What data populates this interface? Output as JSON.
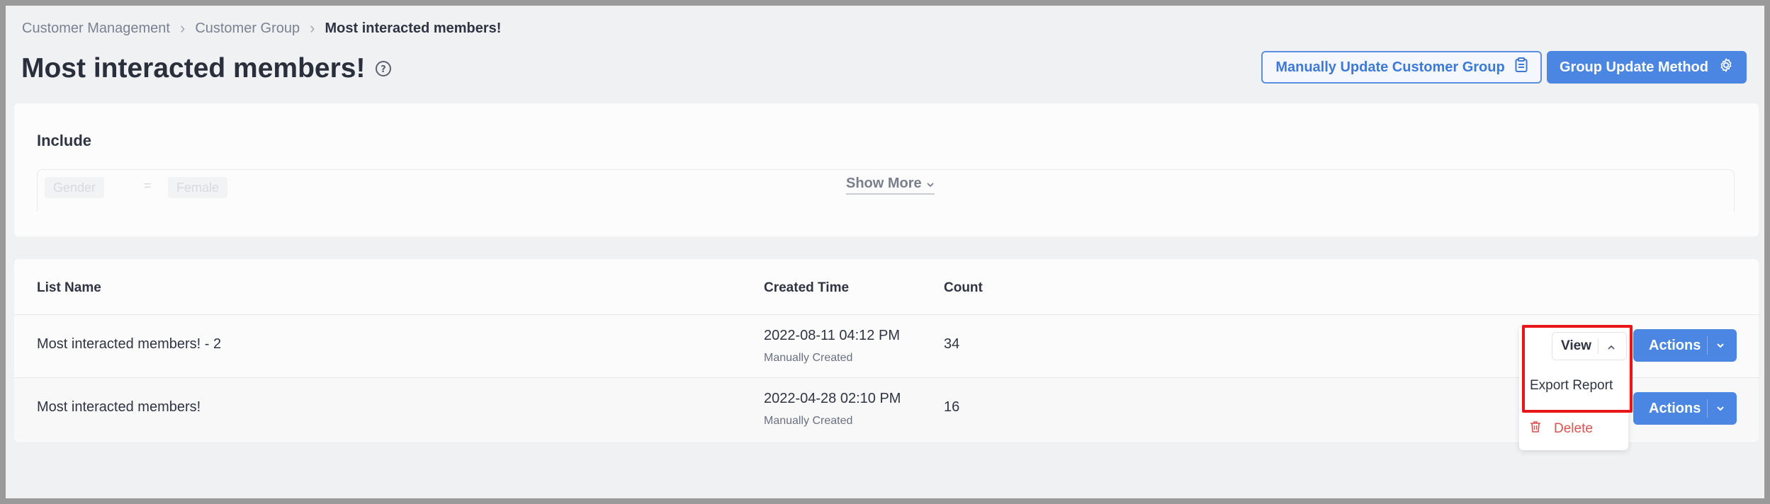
{
  "breadcrumb": {
    "items": [
      "Customer Management",
      "Customer Group"
    ],
    "current": "Most interacted members!"
  },
  "header": {
    "title": "Most interacted members!",
    "manual_update_label": "Manually Update Customer Group",
    "update_method_label": "Group Update Method"
  },
  "include": {
    "title": "Include",
    "rule": {
      "field": "Gender",
      "operator": "=",
      "value": "Female"
    },
    "show_more_label": "Show More"
  },
  "table": {
    "columns": [
      "List Name",
      "Created Time",
      "Count"
    ],
    "rows": [
      {
        "name": "Most interacted members! - 2",
        "time": "2022-08-11 04:12 PM",
        "source": "Manually Created",
        "count": "34"
      },
      {
        "name": "Most interacted members!",
        "time": "2022-04-28 02:10 PM",
        "source": "Manually Created",
        "count": "16"
      }
    ],
    "actions_label": "Actions"
  },
  "dropdown": {
    "view_label": "View",
    "export_label": "Export Report",
    "delete_label": "Delete"
  },
  "colors": {
    "primary": "#4b86e3",
    "danger": "#d9534f",
    "highlight": "#e8161b"
  }
}
